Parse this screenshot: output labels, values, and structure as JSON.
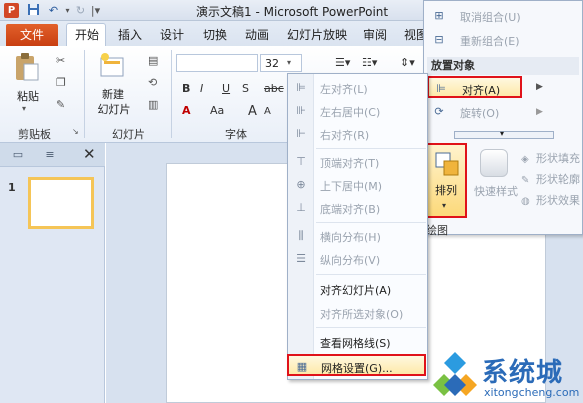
{
  "window": {
    "title": "演示文稿1 - Microsoft PowerPoint",
    "app_icon_letter": "P",
    "qat": {
      "save_icon": "save-icon",
      "undo_icon": "undo-icon",
      "redo_icon": "redo-icon"
    }
  },
  "tabs": {
    "file": "文件",
    "items": [
      "开始",
      "插入",
      "设计",
      "切换",
      "动画",
      "幻灯片放映",
      "审阅",
      "视图"
    ],
    "active": "开始"
  },
  "ribbon": {
    "clipboard": {
      "paste": "粘贴",
      "group": "剪贴板"
    },
    "slides": {
      "new_slide_line1": "新建",
      "new_slide_line2": "幻灯片",
      "group": "幻灯片"
    },
    "font": {
      "size": "32",
      "group": "字体",
      "bold": "B",
      "italic": "I",
      "underline": "U",
      "strike": "S",
      "abc": "abc",
      "grow": "A",
      "shrink": "A",
      "aa": "Aa"
    }
  },
  "left_pane": {
    "slide_number": "1",
    "close": "✕"
  },
  "align_menu": {
    "items": [
      {
        "label": "左对齐(L)",
        "icon": "align-left-icon",
        "enabled": false
      },
      {
        "label": "左右居中(C)",
        "icon": "align-center-icon",
        "enabled": false
      },
      {
        "label": "右对齐(R)",
        "icon": "align-right-icon",
        "enabled": false
      },
      {
        "label": "顶端对齐(T)",
        "icon": "align-top-icon",
        "enabled": false
      },
      {
        "label": "上下居中(M)",
        "icon": "align-middle-icon",
        "enabled": false
      },
      {
        "label": "底端对齐(B)",
        "icon": "align-bottom-icon",
        "enabled": false
      },
      {
        "label": "横向分布(H)",
        "icon": "distribute-horizontal-icon",
        "enabled": false
      },
      {
        "label": "纵向分布(V)",
        "icon": "distribute-vertical-icon",
        "enabled": false
      },
      {
        "label": "对齐幻灯片(A)",
        "icon": "",
        "enabled": true
      },
      {
        "label": "对齐所选对象(O)",
        "icon": "",
        "enabled": false
      },
      {
        "label": "查看网格线(S)",
        "icon": "",
        "enabled": true
      },
      {
        "label": "网格设置(G)...",
        "icon": "grid-icon",
        "enabled": true
      }
    ]
  },
  "arrange_panel": {
    "ungroup": "取消组合(U)",
    "regroup": "重新组合(E)",
    "header": "放置对象",
    "align": "对齐(A)",
    "rotate": "旋转(O)"
  },
  "drawing": {
    "arrange": "排列",
    "quick_styles": "快速样式",
    "shape_fill": "形状填充",
    "shape_outline": "形状轮廓",
    "shape_effects": "形状效果",
    "group_label": "绘图"
  },
  "watermark": {
    "text": "系统城",
    "sub": "xitongcheng.com"
  },
  "colors": {
    "file_tab": "#d24726",
    "highlight_border": "#e0121a",
    "highlight_fill": "#fde9a9",
    "watermark": "#2b6bb8"
  }
}
